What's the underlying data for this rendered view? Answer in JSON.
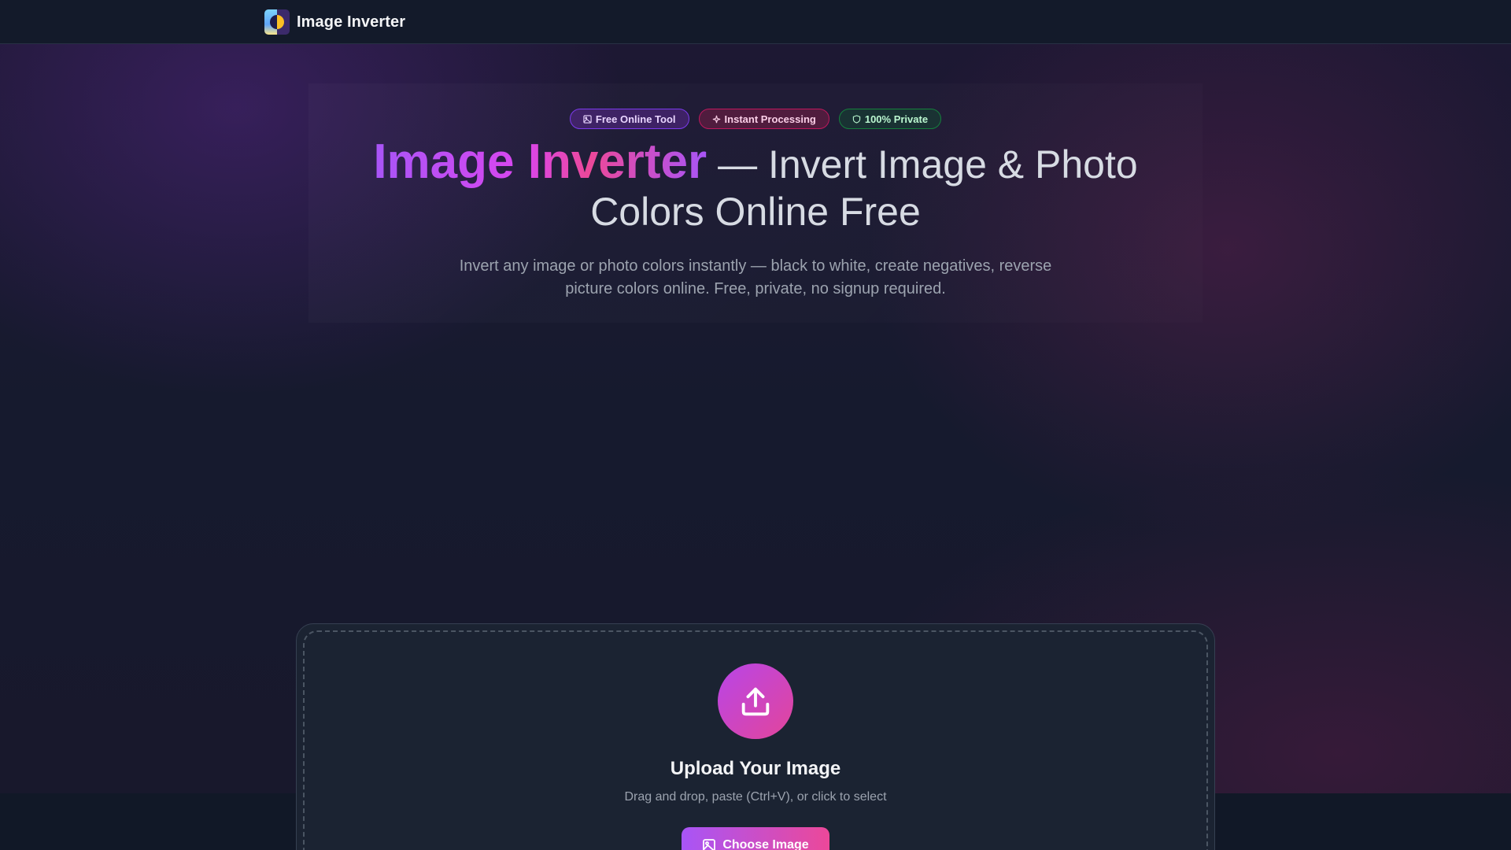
{
  "header": {
    "brand_name": "Image Inverter",
    "logo_icon": "inverter-logo-icon"
  },
  "hero": {
    "badges": [
      {
        "label": "Free Online Tool",
        "icon": "image-icon",
        "color": "#7c3aed"
      },
      {
        "label": "Instant Processing",
        "icon": "sparkle-icon",
        "color": "#be185d"
      },
      {
        "label": "100% Private",
        "icon": "shield-icon",
        "color": "#15803d"
      }
    ],
    "title_highlight": "Image Inverter",
    "title_rest": "— Invert Image & Photo Colors Online Free",
    "subtitle": "Invert any image or photo colors instantly — black to white, create negatives, reverse picture colors online. Free, private, no signup required."
  },
  "upload": {
    "icon": "upload-icon",
    "title": "Upload Your Image",
    "hint": "Drag and drop, paste (Ctrl+V), or click to select",
    "button_label": "Choose Image",
    "button_icon": "image-icon"
  },
  "colors": {
    "accent_purple": "#a855f7",
    "accent_pink": "#ec4899",
    "background": "#111827"
  }
}
